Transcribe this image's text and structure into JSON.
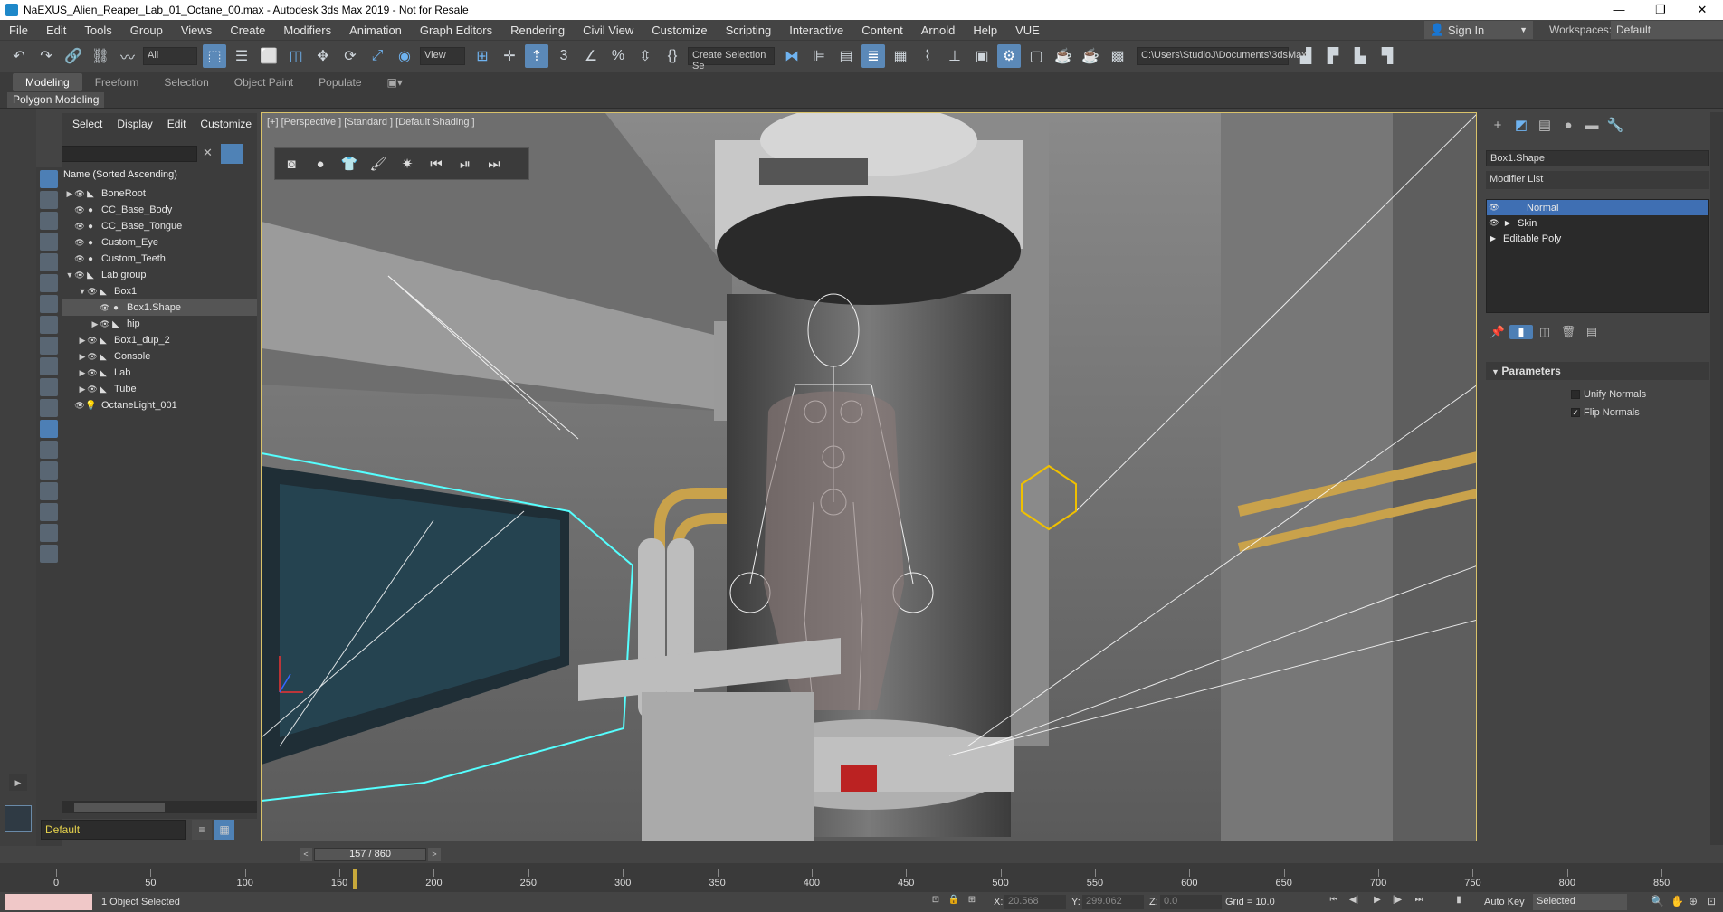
{
  "window": {
    "title": "NaEXUS_Alien_Reaper_Lab_01_Octane_00.max - Autodesk 3ds Max 2019 - Not for Resale",
    "minimize": "—",
    "maximize": "❐",
    "close": "✕"
  },
  "menu": {
    "items": [
      "File",
      "Edit",
      "Tools",
      "Group",
      "Views",
      "Create",
      "Modifiers",
      "Animation",
      "Graph Editors",
      "Rendering",
      "Civil View",
      "Customize",
      "Scripting",
      "Interactive",
      "Content",
      "Arnold",
      "Help",
      "VUE"
    ],
    "sign_in": "Sign In",
    "workspaces_label": "Workspaces:",
    "workspace": "Default"
  },
  "toolbar": {
    "selection_filter": "All",
    "ref_coord": "View",
    "named_sel": "Create Selection Se",
    "project_path": "C:\\Users\\StudioJ\\Documents\\3dsMax"
  },
  "ribbon": {
    "tabs": [
      "Modeling",
      "Freeform",
      "Selection",
      "Object Paint",
      "Populate"
    ],
    "panel": "Polygon Modeling"
  },
  "scene_explorer": {
    "tabs": [
      "Select",
      "Display",
      "Edit",
      "Customize"
    ],
    "header": "Name (Sorted Ascending)",
    "rows": [
      {
        "name": "BoneRoot",
        "arrow": "▶"
      },
      {
        "name": "CC_Base_Body",
        "arrow": ""
      },
      {
        "name": "CC_Base_Tongue",
        "arrow": ""
      },
      {
        "name": "Custom_Eye",
        "arrow": ""
      },
      {
        "name": "Custom_Teeth",
        "arrow": ""
      },
      {
        "name": "Lab group",
        "arrow": "▼"
      },
      {
        "name": "Box1",
        "arrow": "▼"
      },
      {
        "name": "Box1.Shape",
        "arrow": ""
      },
      {
        "name": "hip",
        "arrow": "▶"
      },
      {
        "name": "Box1_dup_2",
        "arrow": "▶"
      },
      {
        "name": "Console",
        "arrow": "▶"
      },
      {
        "name": "Lab",
        "arrow": "▶"
      },
      {
        "name": "Tube",
        "arrow": "▶"
      },
      {
        "name": "OctaneLight_001",
        "arrow": ""
      }
    ],
    "layer": "Default"
  },
  "viewport": {
    "label": "[+] [Perspective ] [Standard ] [Default Shading ]"
  },
  "command_panel": {
    "object_name": "Box1.Shape",
    "modifier_list": "Modifier List",
    "stack": [
      {
        "name": "Normal",
        "selected": true
      },
      {
        "name": "Skin",
        "selected": false
      },
      {
        "name": "Editable Poly",
        "selected": false
      }
    ],
    "rollout": "Parameters",
    "unify_normals": "Unify Normals",
    "flip_normals": "Flip Normals",
    "flip_checked": "✓"
  },
  "timeline": {
    "frame": "157 / 860",
    "current": 157,
    "total": 860,
    "labels": [
      "0",
      "50",
      "100",
      "150",
      "200",
      "250",
      "300",
      "350",
      "400",
      "450",
      "500",
      "550",
      "600",
      "650",
      "700",
      "750",
      "800",
      "850"
    ]
  },
  "status": {
    "objects_selected": "1 Object Selected",
    "x_label": "X:",
    "x": "20.568",
    "y_label": "Y:",
    "y": "299.062",
    "z_label": "Z:",
    "z": "0.0",
    "grid": "Grid = 10.0",
    "auto_key": "Auto Key",
    "key_mode": "Selected"
  }
}
